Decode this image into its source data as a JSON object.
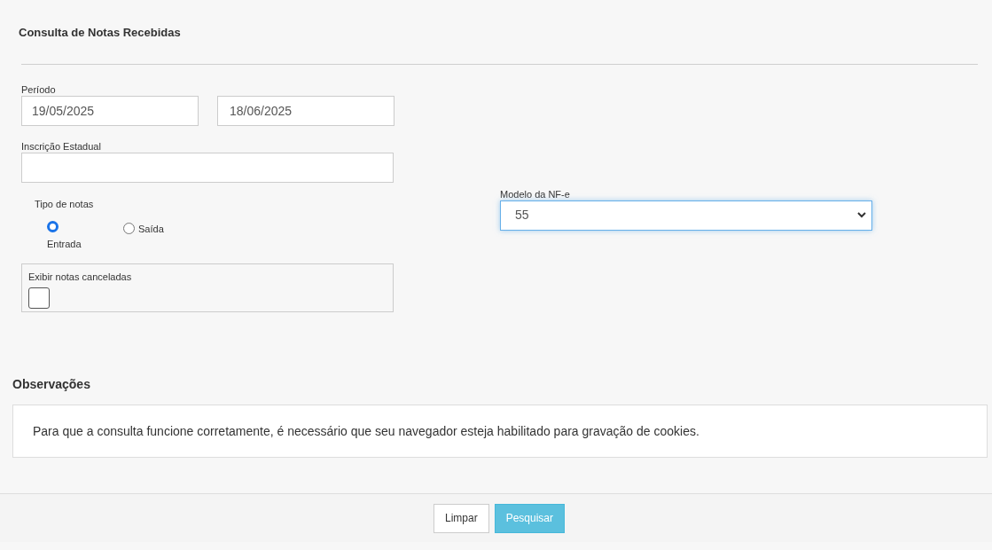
{
  "title": "Consulta de Notas Recebidas",
  "period": {
    "label": "Período",
    "start": "19/05/2025",
    "end": "18/06/2025"
  },
  "state_registration": {
    "label": "Inscrição Estadual"
  },
  "note_type": {
    "label": "Tipo de notas",
    "options": [
      {
        "label": "Entrada",
        "selected": true
      },
      {
        "label": "Saída",
        "selected": false
      }
    ]
  },
  "show_cancelled": {
    "label": "Exibir notas canceladas",
    "checked": false
  },
  "model": {
    "label": "Modelo da NF-e",
    "value": "55"
  },
  "observations": {
    "title": "Observações",
    "text": "Para que a consulta funcione corretamente, é necessário que seu navegador esteja habilitado para gravação de cookies."
  },
  "buttons": [
    {
      "label": "Limpar",
      "kind": "secondary"
    },
    {
      "label": "Pesquisar",
      "kind": "primary"
    }
  ]
}
